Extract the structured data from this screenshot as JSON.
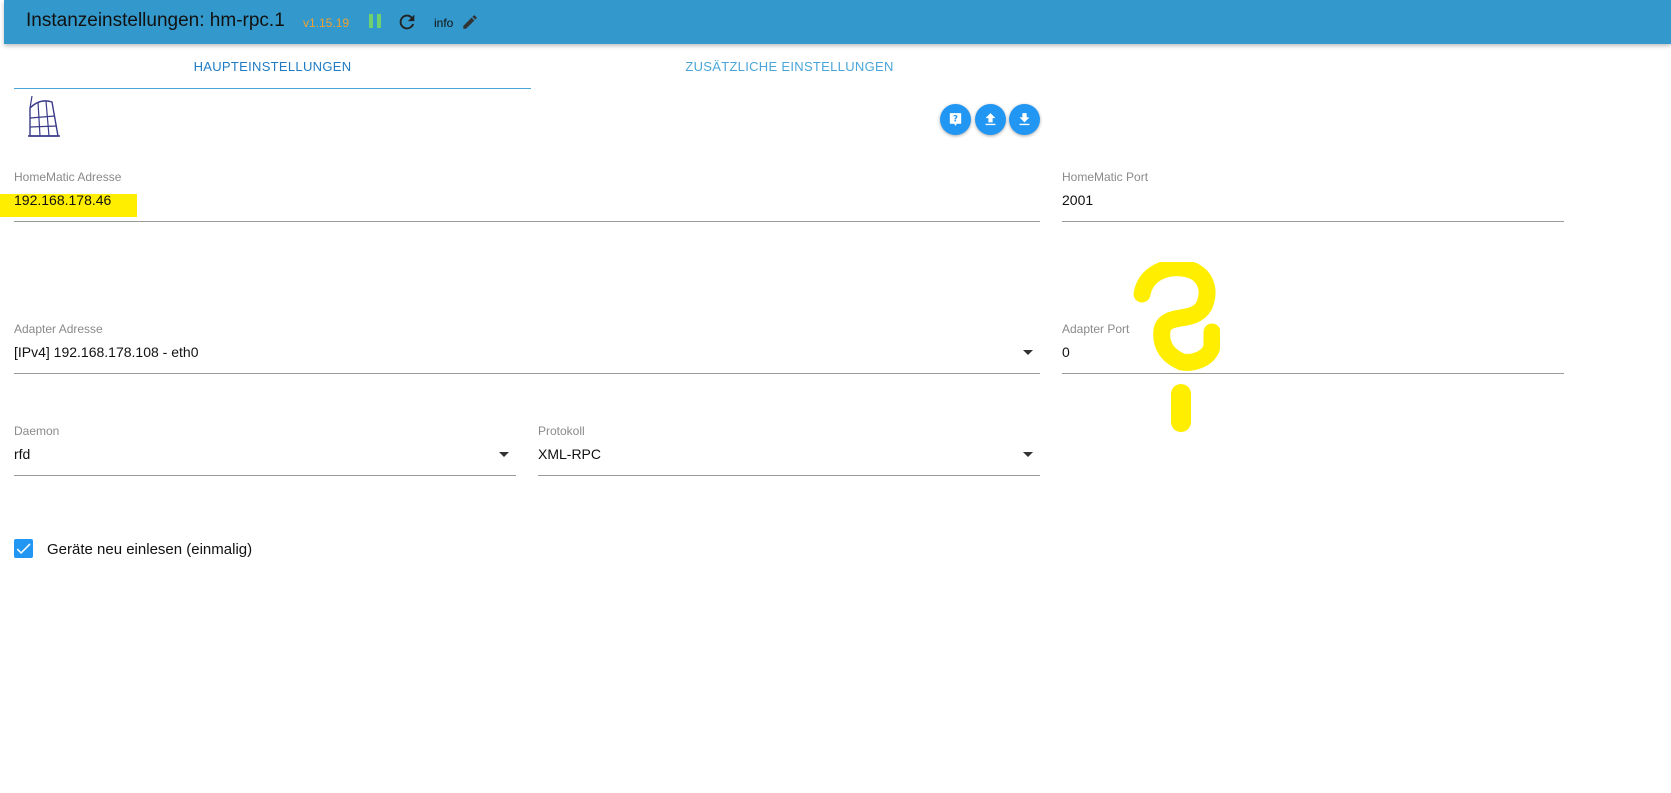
{
  "header": {
    "title": "Instanzeinstellungen: hm-rpc.1",
    "version": "v1.15.19",
    "info_label": "info"
  },
  "tabs": [
    {
      "label": "HAUPTEINSTELLUNGEN",
      "active": true
    },
    {
      "label": "ZUSÄTZLICHE EINSTELLUNGEN",
      "active": false
    }
  ],
  "logo": {
    "text": "HomeMatic"
  },
  "toolbar": {
    "icons": [
      "help-icon",
      "upload-icon",
      "download-icon"
    ]
  },
  "form": {
    "homematic_address": {
      "label": "HomeMatic Adresse",
      "value": "192.168.178.46"
    },
    "homematic_port": {
      "label": "HomeMatic Port",
      "value": "2001"
    },
    "adapter_address": {
      "label": "Adapter Adresse",
      "value": "[IPv4] 192.168.178.108 - eth0"
    },
    "adapter_port": {
      "label": "Adapter Port",
      "value": "0"
    },
    "daemon": {
      "label": "Daemon",
      "value": "rfd"
    },
    "protocol": {
      "label": "Protokoll",
      "value": "XML-RPC"
    },
    "reread_devices": {
      "label": "Geräte neu einlesen (einmalig)",
      "checked": true
    }
  },
  "colors": {
    "header_bg": "#3399cc",
    "accent": "#2196f3",
    "highlight": "#ffee00",
    "version": "#f0a030",
    "running": "#6fd06f"
  }
}
